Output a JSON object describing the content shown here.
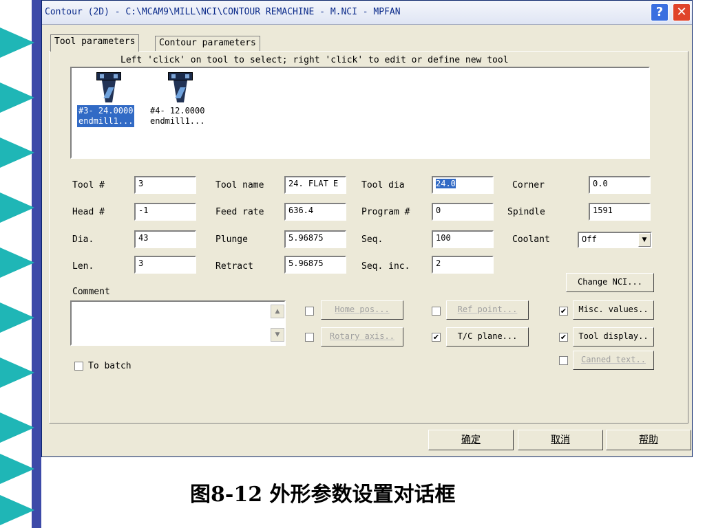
{
  "window": {
    "title": "Contour (2D) - C:\\MCAM9\\MILL\\NCI\\CONTOUR REMACHINE - M.NCI - MPFAN",
    "help_icon": "question-icon",
    "close_icon": "close-icon"
  },
  "tabs": [
    "Tool parameters",
    "Contour parameters"
  ],
  "hint": "Left 'click' on tool to select; right 'click' to edit or define new tool",
  "tools": [
    {
      "line1": "#3- 24.0000",
      "line2": "endmill1...",
      "selected": true
    },
    {
      "line1": "#4- 12.0000",
      "line2": "endmill1...",
      "selected": false
    }
  ],
  "fields": {
    "tool_num": {
      "label": "Tool #",
      "value": "3"
    },
    "head_num": {
      "label": "Head #",
      "value": "-1"
    },
    "dia": {
      "label": "Dia.",
      "value": "43"
    },
    "len": {
      "label": "Len.",
      "value": "3"
    },
    "tool_name": {
      "label": "Tool name",
      "value": "24. FLAT E"
    },
    "feed_rate": {
      "label": "Feed rate",
      "value": "636.4"
    },
    "plunge": {
      "label": "Plunge",
      "value": "5.96875"
    },
    "retract": {
      "label": "Retract",
      "value": "5.96875"
    },
    "tool_dia": {
      "label": "Tool dia",
      "value": "24.0"
    },
    "program_num": {
      "label": "Program #",
      "value": "0"
    },
    "seq": {
      "label": "Seq.",
      "value": "100"
    },
    "seq_inc": {
      "label": "Seq. inc.",
      "value": "2"
    },
    "corner": {
      "label": "Corner",
      "value": "0.0"
    },
    "spindle": {
      "label": "Spindle",
      "value": "1591"
    },
    "coolant": {
      "label": "Coolant",
      "value": "Off"
    }
  },
  "comment_label": "Comment",
  "buttons": {
    "change_nci": "Change NCI...",
    "home_pos": "Home pos...",
    "ref_point": "Ref point...",
    "misc_values": "Misc. values..",
    "rotary_axis": "Rotary axis..",
    "tc_plane": "T/C plane...",
    "tool_display": "Tool display..",
    "canned_text": "Canned text..",
    "to_batch": "To batch"
  },
  "footer": {
    "ok": "确定",
    "cancel": "取消",
    "help": "帮助"
  },
  "caption": "图8-12  外形参数设置对话框"
}
